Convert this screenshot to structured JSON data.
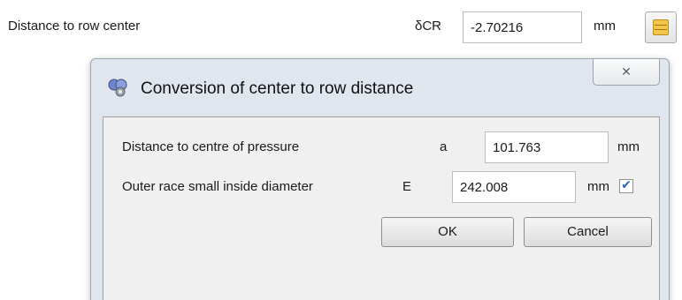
{
  "main": {
    "distance_label": "Distance to row center",
    "symbol": "δCR",
    "value": "-2.70216",
    "unit": "mm",
    "convert_icon": "stack-icon"
  },
  "dialog": {
    "title": "Conversion of center to row distance",
    "app_icon": "app-icon",
    "close_glyph": "✕",
    "rows": [
      {
        "label": "Distance to centre of pressure",
        "symbol": "a",
        "value": "101.763",
        "unit": "mm"
      },
      {
        "label": "Outer race small inside diameter",
        "symbol": "E",
        "value": "242.008",
        "unit": "mm",
        "checked": true
      }
    ],
    "ok_label": "OK",
    "cancel_label": "Cancel"
  },
  "colors": {
    "check_color": "#2a63b8",
    "dialog_frame": "#dfe6ee"
  }
}
